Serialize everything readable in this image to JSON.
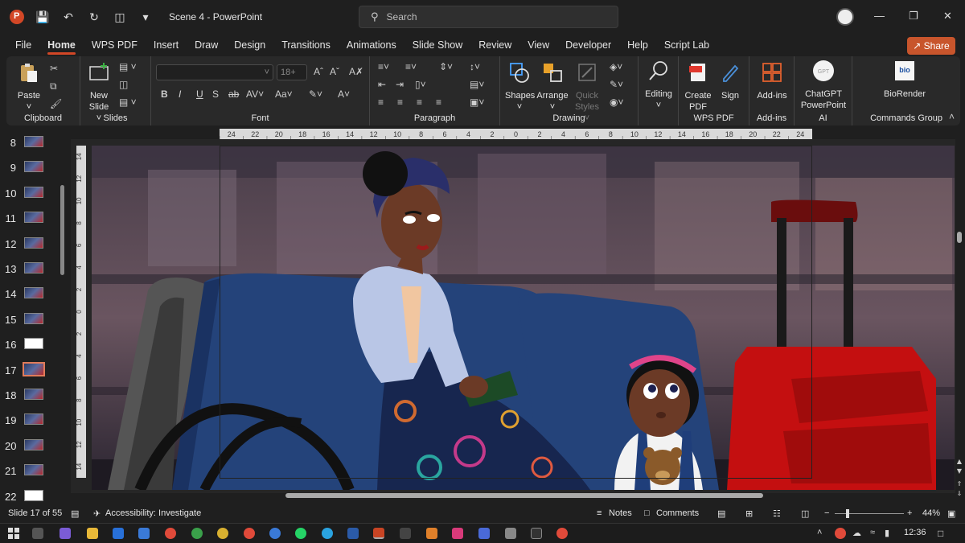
{
  "window": {
    "doc_title": "Scene 4  -  PowerPoint",
    "search_placeholder": "Search"
  },
  "tabs": [
    "File",
    "Home",
    "WPS PDF",
    "Insert",
    "Draw",
    "Design",
    "Transitions",
    "Animations",
    "Slide Show",
    "Review",
    "View",
    "Developer",
    "Help",
    "Script Lab"
  ],
  "share_label": "Share",
  "ribbon": {
    "clipboard": {
      "paste": "Paste",
      "label": "Clipboard"
    },
    "slides": {
      "new_slide_1": "New",
      "new_slide_2": "Slide",
      "label": "Slides"
    },
    "font": {
      "size": "18+",
      "label": "Font",
      "bold": "B",
      "italic": "I",
      "underline": "U",
      "shadow": "S",
      "strike": "ab"
    },
    "paragraph": {
      "label": "Paragraph"
    },
    "drawing": {
      "shapes": "Shapes",
      "arrange": "Arrange",
      "quick_1": "Quick",
      "quick_2": "Styles",
      "label": "Drawing"
    },
    "editing": {
      "label": "Editing"
    },
    "wps_pdf": {
      "create_1": "Create",
      "create_2": "PDF",
      "sign": "Sign",
      "label": "WPS PDF"
    },
    "addins": {
      "btn": "Add-ins",
      "label": "Add-ins"
    },
    "ai": {
      "btn_1": "ChatGPT",
      "btn_2": "PowerPoint",
      "label": "AI"
    },
    "commands": {
      "btn": "BioRender",
      "label": "Commands Group"
    }
  },
  "thumbnails": [
    {
      "num": "8",
      "kind": "scene"
    },
    {
      "num": "9",
      "kind": "scene"
    },
    {
      "num": "10",
      "kind": "scene"
    },
    {
      "num": "11",
      "kind": "scene"
    },
    {
      "num": "12",
      "kind": "scene"
    },
    {
      "num": "13",
      "kind": "scene"
    },
    {
      "num": "14",
      "kind": "scene"
    },
    {
      "num": "15",
      "kind": "scene"
    },
    {
      "num": "16",
      "kind": "white"
    },
    {
      "num": "17",
      "kind": "selected"
    },
    {
      "num": "18",
      "kind": "scene"
    },
    {
      "num": "19",
      "kind": "scene"
    },
    {
      "num": "20",
      "kind": "scene"
    },
    {
      "num": "21",
      "kind": "scene"
    },
    {
      "num": "22",
      "kind": "white"
    }
  ],
  "ruler_h": [
    "24",
    "22",
    "20",
    "18",
    "16",
    "14",
    "12",
    "10",
    "8",
    "6",
    "4",
    "2",
    "0",
    "2",
    "4",
    "6",
    "8",
    "10",
    "12",
    "14",
    "16",
    "18",
    "20",
    "22",
    "24"
  ],
  "ruler_v": [
    "14",
    "12",
    "10",
    "8",
    "6",
    "4",
    "2",
    "0",
    "2",
    "4",
    "6",
    "8",
    "10",
    "12",
    "14"
  ],
  "status": {
    "slide_info": "Slide 17 of 55",
    "accessibility": "Accessibility: Investigate",
    "notes": "Notes",
    "comments": "Comments",
    "zoom": "44%"
  },
  "taskbar": {
    "time": "12:36"
  },
  "colors": {
    "accent": "#d24726",
    "share": "#c8552c",
    "suitcase": "#c40f10",
    "couch": "#24437a"
  }
}
